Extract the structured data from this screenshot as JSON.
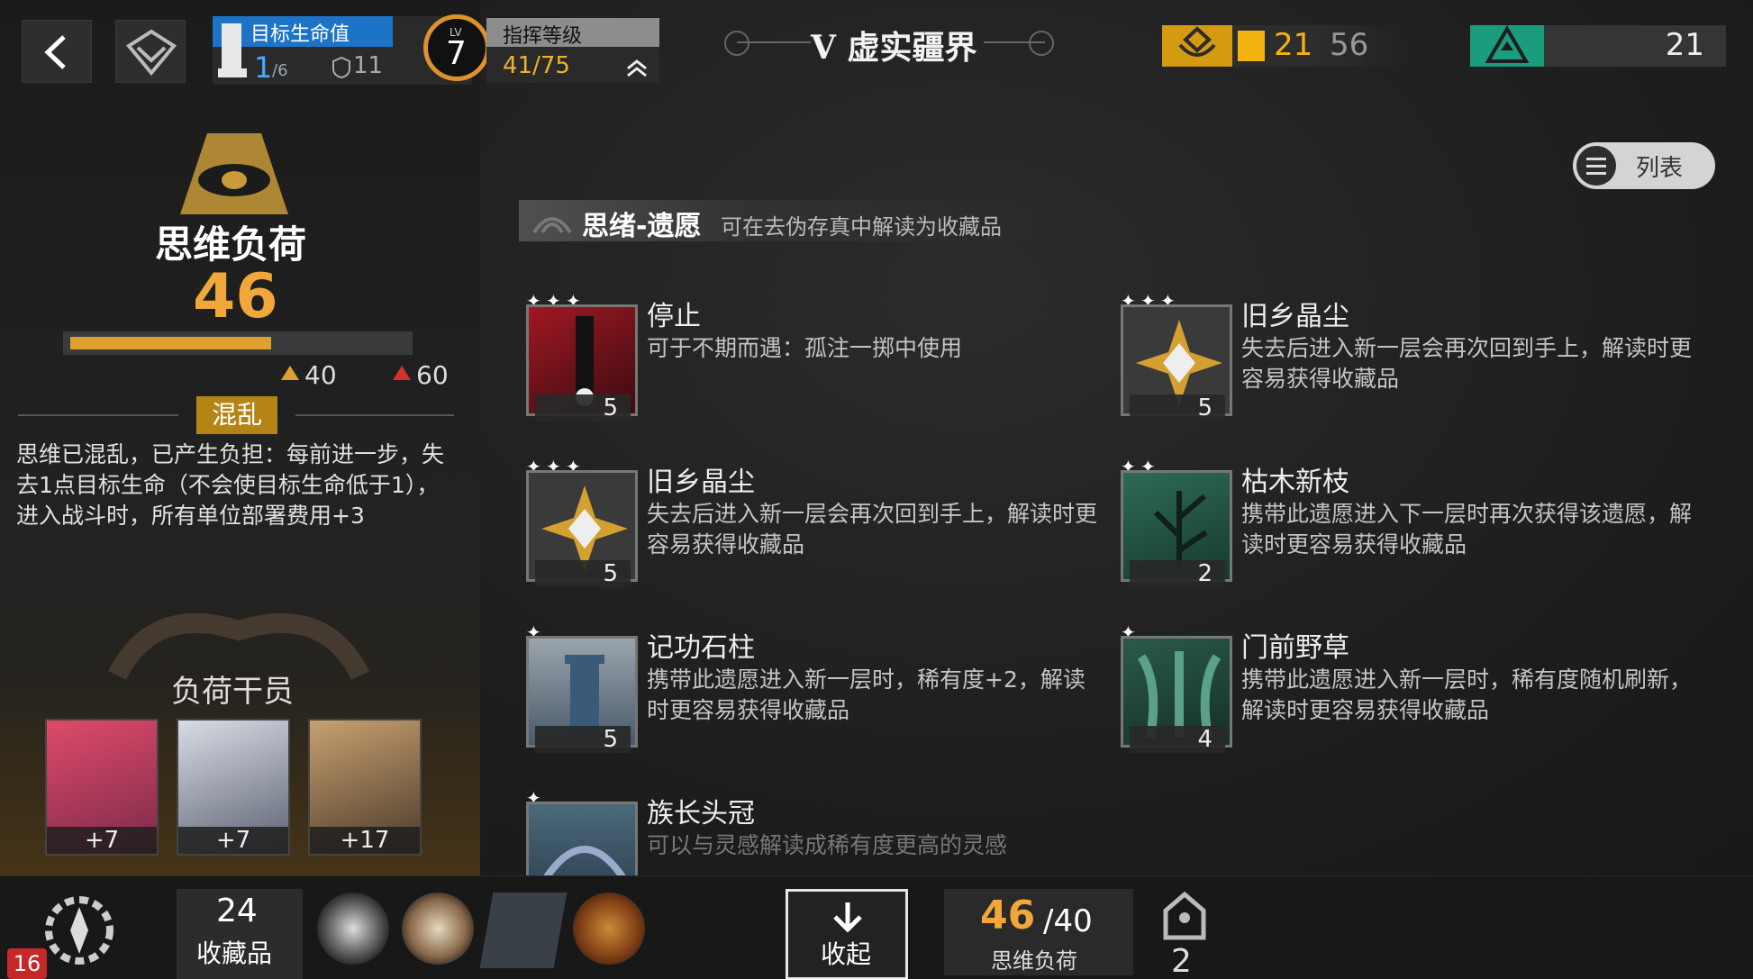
{
  "topbar": {
    "life_title": "目标生命值",
    "life_value": "1",
    "life_max": "/6",
    "shield_value": "11",
    "lv_label": "LV",
    "level": "7",
    "command_title": "指挥等级",
    "command_value": "41/75",
    "zone_title": "V 虚实疆界",
    "ingot_value": "21",
    "ingot_max": "56",
    "hope_value": "21"
  },
  "load_panel": {
    "title": "思维负荷",
    "value": "46",
    "fill_fraction": 0.6,
    "threshold_1": "40",
    "threshold_2": "60",
    "state": "混乱",
    "state_desc": "思维已混乱，已产生负担：每前进一步，失去1点目标生命（不会使目标生命低于1），进入战斗时，所有单位部署费用+3",
    "operators_title": "负荷干员",
    "operators": [
      {
        "bonus": "+7"
      },
      {
        "bonus": "+7"
      },
      {
        "bonus": "+17"
      }
    ]
  },
  "main": {
    "list_toggle": "列表",
    "section_title": "思绪-遗愿",
    "section_sub": "可在去伪存真中解读为收藏品",
    "relics": [
      {
        "name": "停止",
        "desc": "可于不期而遇：孤注一掷中使用",
        "cost": "5",
        "stars": 3
      },
      {
        "name": "旧乡晶尘",
        "desc": "失去后进入新一层会再次回到手上，解读时更容易获得收藏品",
        "cost": "5",
        "stars": 3
      },
      {
        "name": "旧乡晶尘",
        "desc": "失去后进入新一层会再次回到手上，解读时更容易获得收藏品",
        "cost": "5",
        "stars": 3
      },
      {
        "name": "枯木新枝",
        "desc": "携带此遗愿进入下一层时再次获得该遗愿，解读时更容易获得收藏品",
        "cost": "2",
        "stars": 2
      },
      {
        "name": "记功石柱",
        "desc": "携带此遗愿进入新一层时，稀有度+2，解读时更容易获得收藏品",
        "cost": "5",
        "stars": 1
      },
      {
        "name": "门前野草",
        "desc": "携带此遗愿进入新一层时，稀有度随机刷新，解读时更容易获得收藏品",
        "cost": "4",
        "stars": 1
      },
      {
        "name": "族长头冠",
        "desc": "可以与灵感解读成稀有度更高的灵感",
        "cost": "",
        "stars": 1
      }
    ]
  },
  "bottom": {
    "badge": "16",
    "collection_count": "24",
    "collection_label": "收藏品",
    "collapse_label": "收起",
    "load_value": "46",
    "load_max": "/40",
    "load_label": "思维负荷",
    "key_count": "2"
  },
  "colors": {
    "accent_orange": "#f1a73a",
    "life_blue": "#1d74c7",
    "ingot_gold": "#f5b30f",
    "hope_green": "#1a9c7d"
  }
}
